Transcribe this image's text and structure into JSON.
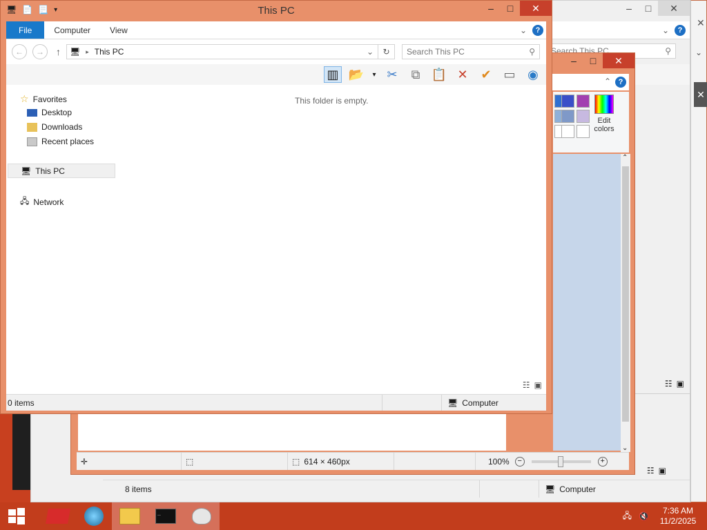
{
  "colors": {
    "accent": "#1979ca",
    "frame": "#e8906a",
    "close": "#c7402b",
    "taskbar": "#c23d1c"
  },
  "main_window": {
    "title": "This PC",
    "ribbon_tabs": [
      "File",
      "Computer",
      "View"
    ],
    "address": "This PC",
    "search_placeholder": "Search This PC",
    "empty_message": "This folder is empty.",
    "nav": {
      "favorites": "Favorites",
      "desktop": "Desktop",
      "downloads": "Downloads",
      "recent": "Recent places",
      "this_pc": "This PC",
      "network": "Network"
    },
    "status_items": "0 items",
    "status_location": "Computer"
  },
  "back_window": {
    "search_placeholder": "Search This PC"
  },
  "paint_window": {
    "edit_colors": "Edit colors",
    "dimensions": "614 × 460px",
    "zoom": "100%"
  },
  "explorer_bottom": {
    "status_items": "8 items",
    "status_location": "Computer"
  },
  "taskbar": {
    "time": "7:36 AM",
    "date": "11/2/2025"
  }
}
